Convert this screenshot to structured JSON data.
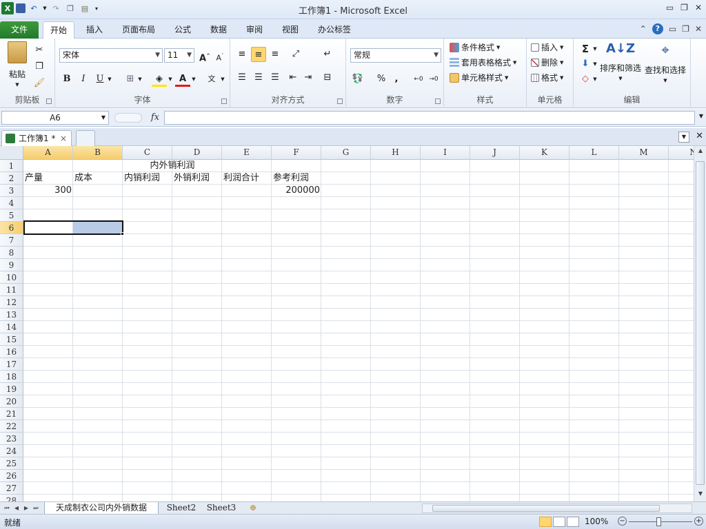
{
  "window": {
    "title": "工作簿1  -  Microsoft Excel"
  },
  "ribbon_tabs": [
    "文件",
    "开始",
    "插入",
    "页面布局",
    "公式",
    "数据",
    "审阅",
    "视图",
    "办公标签"
  ],
  "ribbon": {
    "clipboard": {
      "label": "剪贴板",
      "paste": "粘贴"
    },
    "font": {
      "label": "字体",
      "font_name": "宋体",
      "font_size": "11",
      "bold": "B",
      "italic": "I",
      "underline": "U"
    },
    "alignment": {
      "label": "对齐方式"
    },
    "number": {
      "label": "数字",
      "format": "常规",
      "percent": "%",
      "comma": ","
    },
    "styles": {
      "label": "样式",
      "conditional": "条件格式",
      "table": "套用表格格式",
      "cell_styles": "单元格样式"
    },
    "cells": {
      "label": "单元格",
      "insert": "插入",
      "delete": "删除",
      "format": "格式"
    },
    "editing": {
      "label": "编辑",
      "sum": "Σ",
      "sort": "排序和筛选",
      "find": "查找和选择"
    }
  },
  "formula_bar": {
    "name_box": "A6",
    "fx": "fx",
    "content": ""
  },
  "workbook_tab": {
    "name": "工作簿1 *",
    "close": "×"
  },
  "columns": [
    "A",
    "B",
    "C",
    "D",
    "E",
    "F",
    "G",
    "H",
    "I",
    "J",
    "K",
    "L",
    "M",
    "N"
  ],
  "rows": [
    "1",
    "2",
    "3",
    "4",
    "5",
    "6",
    "7",
    "8",
    "9",
    "10",
    "11",
    "12",
    "13",
    "14",
    "15",
    "16",
    "17",
    "18",
    "19",
    "20",
    "21",
    "22",
    "23",
    "24",
    "25",
    "26",
    "27",
    "28"
  ],
  "cells": {
    "C1": "内外销利润",
    "A2": "产量",
    "B2": "成本",
    "C2": "内销利润",
    "D2": "外销利润",
    "E2": "利润合计",
    "F2": "参考利润",
    "A3": "300",
    "F3": "200000"
  },
  "selection": {
    "active_cell": "A6",
    "range": "A6:B6"
  },
  "sheets": [
    "天成制衣公司内外销数据",
    "Sheet2",
    "Sheet3"
  ],
  "status": {
    "text": "就绪",
    "zoom": "100%"
  },
  "colors": {
    "file_tab": "#217a2b",
    "selection_fill": "#b9cbe6",
    "header_highlight": "#f6cd6c"
  }
}
